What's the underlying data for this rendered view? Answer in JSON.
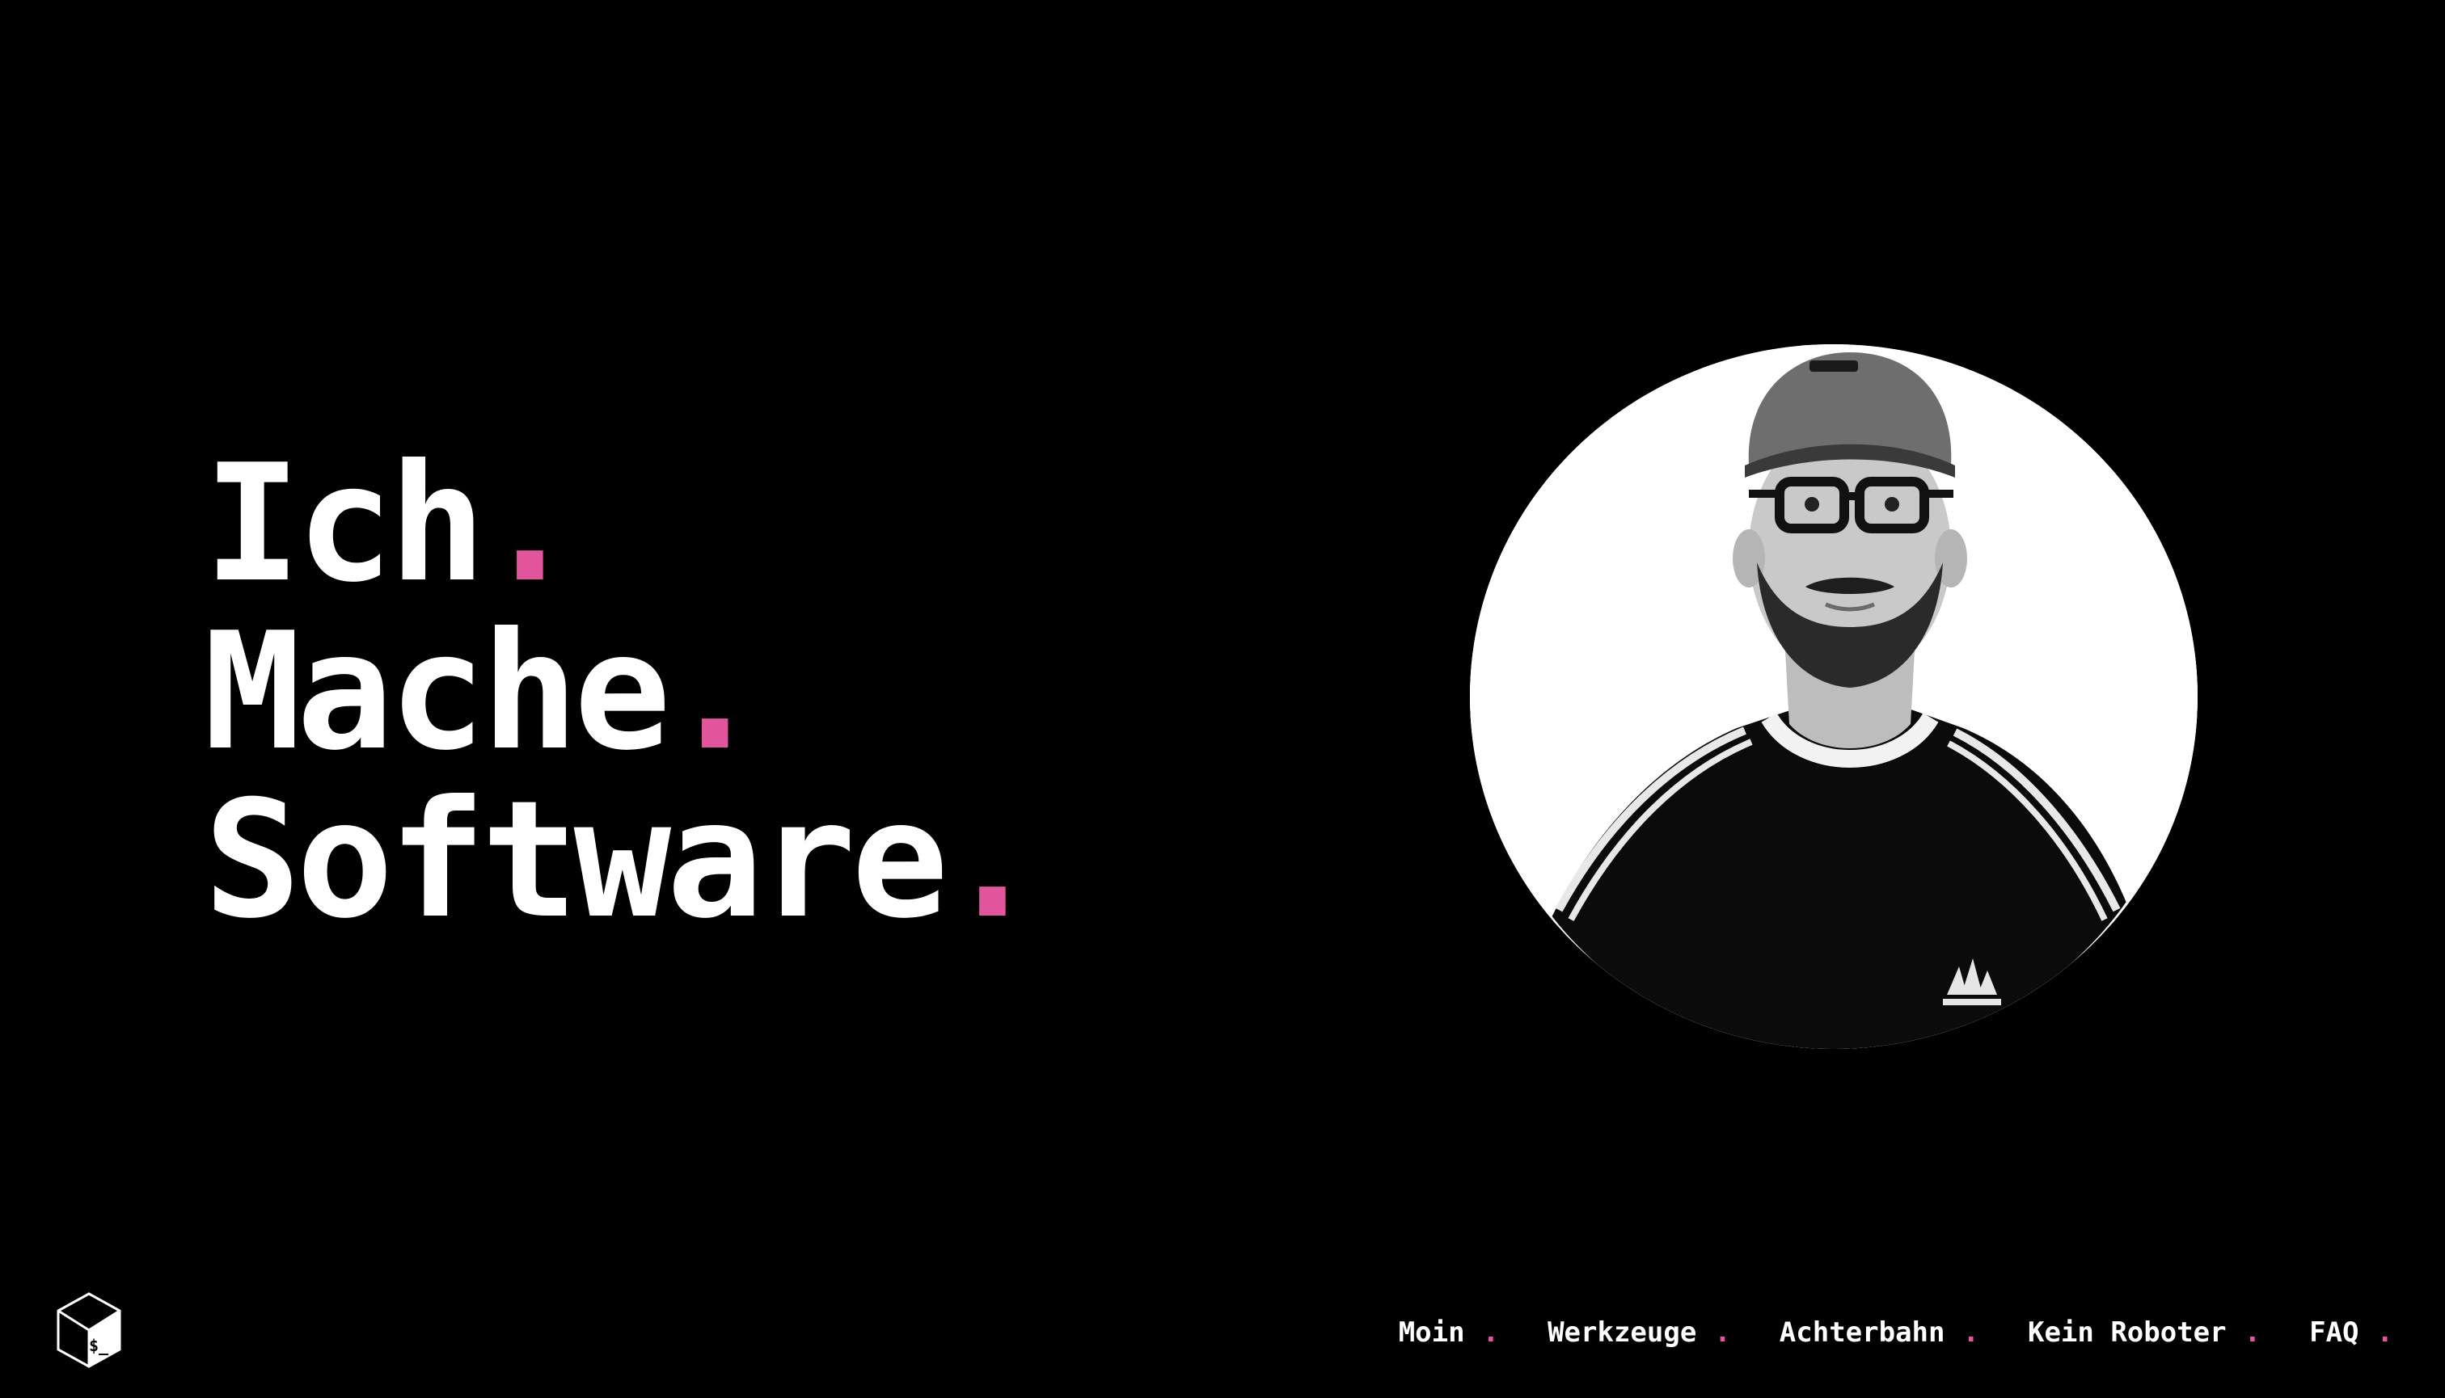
{
  "hero": {
    "lines": [
      {
        "text": "Ich",
        "dot": "."
      },
      {
        "text": "Mache",
        "dot": "."
      },
      {
        "text": "Software",
        "dot": "."
      }
    ]
  },
  "nav": {
    "items": [
      {
        "label": "Moin",
        "dot": "."
      },
      {
        "label": "Werkzeuge",
        "dot": "."
      },
      {
        "label": "Achterbahn",
        "dot": "."
      },
      {
        "label": "Kein Roboter",
        "dot": "."
      },
      {
        "label": "FAQ",
        "dot": "."
      }
    ]
  },
  "logo": {
    "glyph": "$_",
    "icon": "terminal-cube-icon"
  },
  "portrait": {
    "icon": "profile-photo"
  },
  "colors": {
    "background": "#000000",
    "text": "#ffffff",
    "accent": "#e0559c"
  }
}
